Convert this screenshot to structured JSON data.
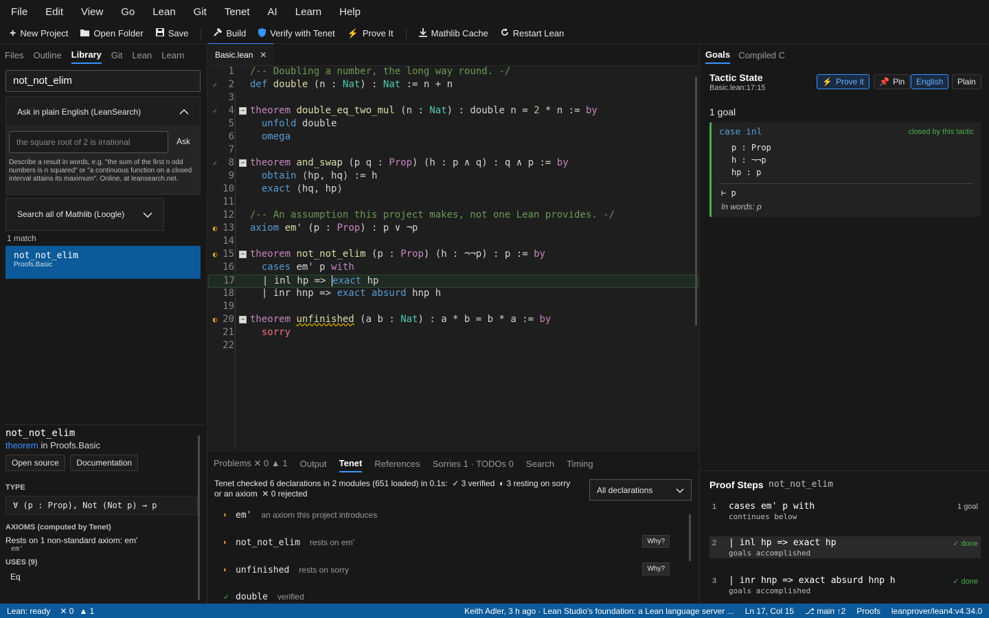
{
  "menu": [
    "File",
    "Edit",
    "View",
    "Go",
    "Lean",
    "Git",
    "Tenet",
    "AI",
    "Learn",
    "Help"
  ],
  "toolbar": {
    "new_project": "New Project",
    "open_folder": "Open Folder",
    "save": "Save",
    "build": "Build",
    "verify": "Verify with Tenet",
    "prove": "Prove It",
    "mathlib": "Mathlib Cache",
    "restart": "Restart Lean"
  },
  "left": {
    "tabs": [
      "Files",
      "Outline",
      "Library",
      "Git",
      "Lean",
      "Learn"
    ],
    "search_value": "not_not_elim",
    "ask_title": "Ask in plain English (LeanSearch)",
    "ask_placeholder": "the square root of 2 is irrational",
    "ask_button": "Ask",
    "ask_desc": "Describe a result in words, e.g. \"the sum of the first n odd numbers is n squared\" or \"a continuous function on a closed interval attains its maximum\". Online, at leansearch.net.",
    "loogle": "Search all of Mathlib (Loogle)",
    "match_count": "1 match",
    "result_name": "not_not_elim",
    "result_module": "Proofs.Basic",
    "detail": {
      "name": "not_not_elim",
      "kind": "theorem",
      "in": "in",
      "module": "Proofs.Basic",
      "open_source": "Open source",
      "documentation": "Documentation",
      "type_head": "TYPE",
      "type": "∀ (p : Prop), Not (Not p) → p",
      "axioms_head": "AXIOMS (computed by Tenet)",
      "axioms_text": "Rests on 1 non-standard axiom: em'",
      "axiom_item": "em'",
      "uses_head": "USES (9)",
      "uses_item": "Eq"
    }
  },
  "editor": {
    "tab": "Basic.lean"
  },
  "bottom": {
    "tabs": {
      "problems": "Problems",
      "err": "✕ 0",
      "warn": "▲ 1",
      "output": "Output",
      "tenet": "Tenet",
      "references": "References",
      "sorries": "Sorries 1 · TODOs 0",
      "search": "Search",
      "timing": "Timing"
    },
    "summary1": "Tenet checked 6 declarations in 2 modules (651 loaded) in 0.1s:",
    "verified": "3 verified",
    "resting": "3 resting on sorry or an axiom",
    "rejected": "0 rejected",
    "select": "All declarations",
    "decls": [
      {
        "name": "em'",
        "desc": "an axiom this project introduces"
      },
      {
        "name": "not_not_elim",
        "desc": "rests on em'",
        "why": "Why?"
      },
      {
        "name": "unfinished",
        "desc": "rests on sorry",
        "why": "Why?"
      },
      {
        "name": "double",
        "desc": "verified"
      }
    ]
  },
  "right": {
    "tabs": [
      "Goals",
      "Compiled C"
    ],
    "title": "Tactic State",
    "sub": "Basic.lean:17:15",
    "prove": "Prove it",
    "pin": "Pin",
    "english": "English",
    "plain": "Plain",
    "goal_count": "1 goal",
    "case_kw": "case",
    "case_name": "inl",
    "closed": "closed by this tactic",
    "hyps": [
      "p : Prop",
      "h : ¬¬p",
      "hp : p"
    ],
    "target": "⊢ p",
    "words": "In words: p",
    "steps_title": "Proof Steps",
    "steps_name": "not_not_elim",
    "steps": [
      {
        "n": "1",
        "code": "cases em' p with",
        "sub": "continues below",
        "right": "1 goal"
      },
      {
        "n": "2",
        "code": "| inl hp => exact hp",
        "sub": "goals accomplished",
        "right": "✓ done"
      },
      {
        "n": "3",
        "code": "| inr hnp => exact absurd hnp h",
        "sub": "goals accomplished",
        "right": "✓ done"
      }
    ]
  },
  "status": {
    "lean": "Lean: ready",
    "err": "✕ 0",
    "warn": "▲ 1",
    "commit": "Keith Adler, 3 h ago · Lean Studio's foundation: a Lean language server ...",
    "pos": "Ln 17, Col 15",
    "branch": "⎇ main ↑2",
    "proofs": "Proofs",
    "toolchain": "leanprover/lean4:v4.34.0"
  }
}
